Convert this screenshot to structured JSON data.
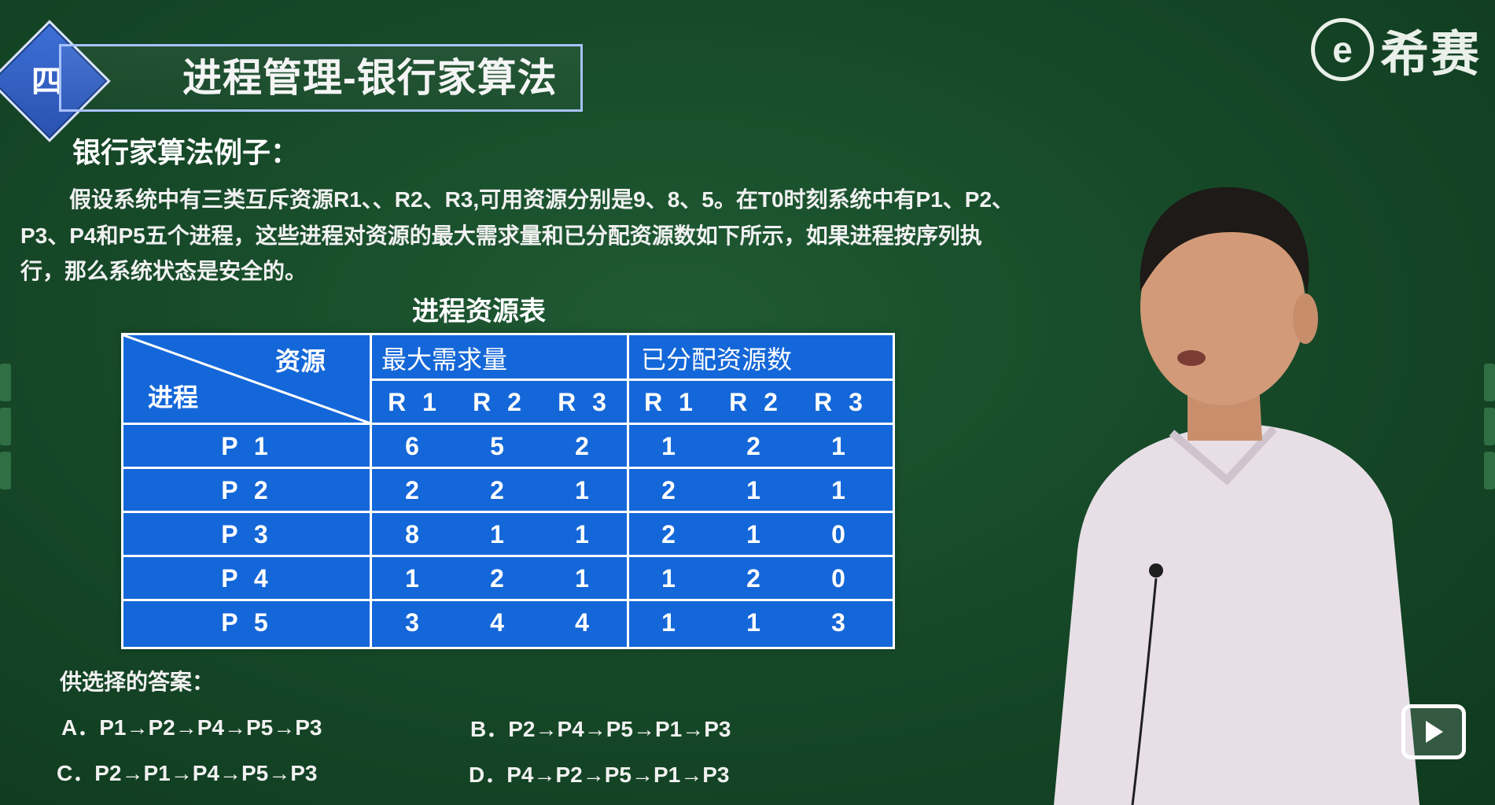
{
  "header": {
    "badge": "四",
    "title": "进程管理-银行家算法"
  },
  "logo": {
    "mark": "e",
    "text": "希赛"
  },
  "content": {
    "section_heading": "银行家算法例子：",
    "paragraph_lines": [
      "假设系统中有三类互斥资源R1、、R2、R3,可用资源分别是9、8、5。在T0时刻系统中有P1、P2、",
      "P3、P4和P5五个进程，这些进程对资源的最大需求量和已分配资源数如下所示，如果进程按序列执",
      "行，那么系统状态是安全的。"
    ],
    "table_title": "进程资源表"
  },
  "table": {
    "corner_top": "资源",
    "corner_bottom": "进程",
    "group_max": "最大需求量",
    "group_alloc": "已分配资源数",
    "sub_headers": [
      "R 1",
      "R 2",
      "R 3",
      "R 1",
      "R 2",
      "R 3"
    ],
    "rows": [
      {
        "process": "P 1",
        "values": [
          "6",
          "5",
          "2",
          "1",
          "2",
          "1"
        ]
      },
      {
        "process": "P 2",
        "values": [
          "2",
          "2",
          "1",
          "2",
          "1",
          "1"
        ]
      },
      {
        "process": "P 3",
        "values": [
          "8",
          "1",
          "1",
          "2",
          "1",
          "0"
        ]
      },
      {
        "process": "P 4",
        "values": [
          "1",
          "2",
          "1",
          "1",
          "2",
          "0"
        ]
      },
      {
        "process": "P 5",
        "values": [
          "3",
          "4",
          "4",
          "1",
          "1",
          "3"
        ]
      }
    ]
  },
  "answers": {
    "label": "供选择的答案：",
    "a": "A．P1→P2→P4→P5→P3",
    "b": "B．P2→P4→P5→P1→P3",
    "c": "C．P2→P1→P4→P5→P3",
    "d": "D．P4→P2→P5→P1→P3"
  },
  "icons": {
    "play": "play-icon"
  }
}
